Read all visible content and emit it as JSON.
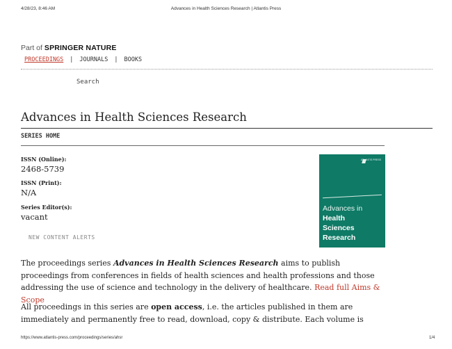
{
  "print_header": {
    "timestamp": "4/28/23, 8:46 AM",
    "title": "Advances in Health Sciences Research | Atlantis Press"
  },
  "brand": {
    "part_of": "Part of",
    "name": "SPRINGER NATURE"
  },
  "nav": {
    "items": [
      {
        "label": "PROCEEDINGS"
      },
      {
        "label": "JOURNALS"
      },
      {
        "label": "BOOKS"
      }
    ],
    "separator": "|"
  },
  "search": {
    "label": "Search"
  },
  "page": {
    "title": "Advances in Health Sciences Research",
    "series_home": "SERIES HOME"
  },
  "meta": {
    "issn_online_label": "ISSN (Online):",
    "issn_online": "2468-5739",
    "issn_print_label": "ISSN (Print):",
    "issn_print": "N/A",
    "editor_label": "Series Editor(s):",
    "editor": "vacant"
  },
  "alerts": {
    "label": "NEW CONTENT ALERTS"
  },
  "cover": {
    "publisher": "ATLANTIS PRESS",
    "line1": "Advances in",
    "line2": "Health",
    "line3": "Sciences",
    "line4": "Research"
  },
  "para1": {
    "lead": "The proceedings series ",
    "series_name": "Advances in Health Sciences Research",
    "rest": " aims to publish proceedings from conferences in fields of health sciences and health professions and those addressing the use of science and technology in the delivery of healthcare. ",
    "link": "Read full Aims & Scope"
  },
  "para2": {
    "lead": "All proceedings in this series are ",
    "bold": "open access",
    "rest": ", i.e. the articles published in them are immediately and permanently free to read, download, copy & distribute. Each volume is"
  },
  "print_footer": {
    "url": "https://www.atlantis-press.com/proceedings/series/ahsr",
    "page": "1/4"
  }
}
